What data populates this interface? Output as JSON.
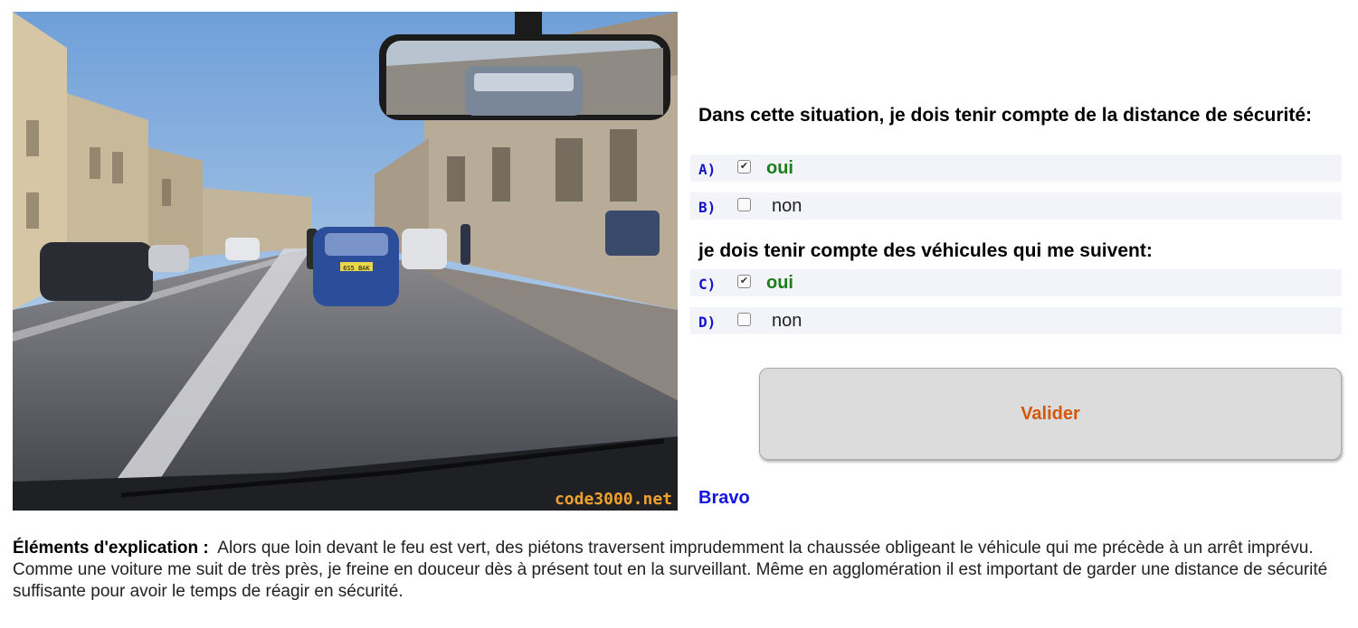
{
  "image": {
    "watermark": "code3000.net",
    "plate_text": "6S5 BAK"
  },
  "question1": "Dans cette situation, je dois tenir compte de la distance de sécurité:",
  "question2": "je dois tenir compte des véhicules qui me suivent:",
  "answers": [
    {
      "letter": "A)",
      "text": "oui",
      "checked": true
    },
    {
      "letter": "B)",
      "text": "non",
      "checked": false
    },
    {
      "letter": "C)",
      "text": "oui",
      "checked": true
    },
    {
      "letter": "D)",
      "text": "non",
      "checked": false
    }
  ],
  "validate_label": "Valider",
  "result": "Bravo",
  "explanation": {
    "title": "Éléments d'explication :",
    "text": "Alors que loin devant le feu est vert, des piétons traversent imprudemment la chaussée obligeant le véhicule qui me précède à un arrêt imprévu. Comme une voiture me suit de très près, je freine en douceur dès à présent tout en la surveillant. Même en agglomération il est important de garder une distance de sécurité suffisante pour avoir le temps de réagir en sécurité."
  },
  "colors": {
    "letter": "#1313c8",
    "correct": "#1a7d1a",
    "button_text": "#d2580a",
    "result": "#1313e8"
  }
}
